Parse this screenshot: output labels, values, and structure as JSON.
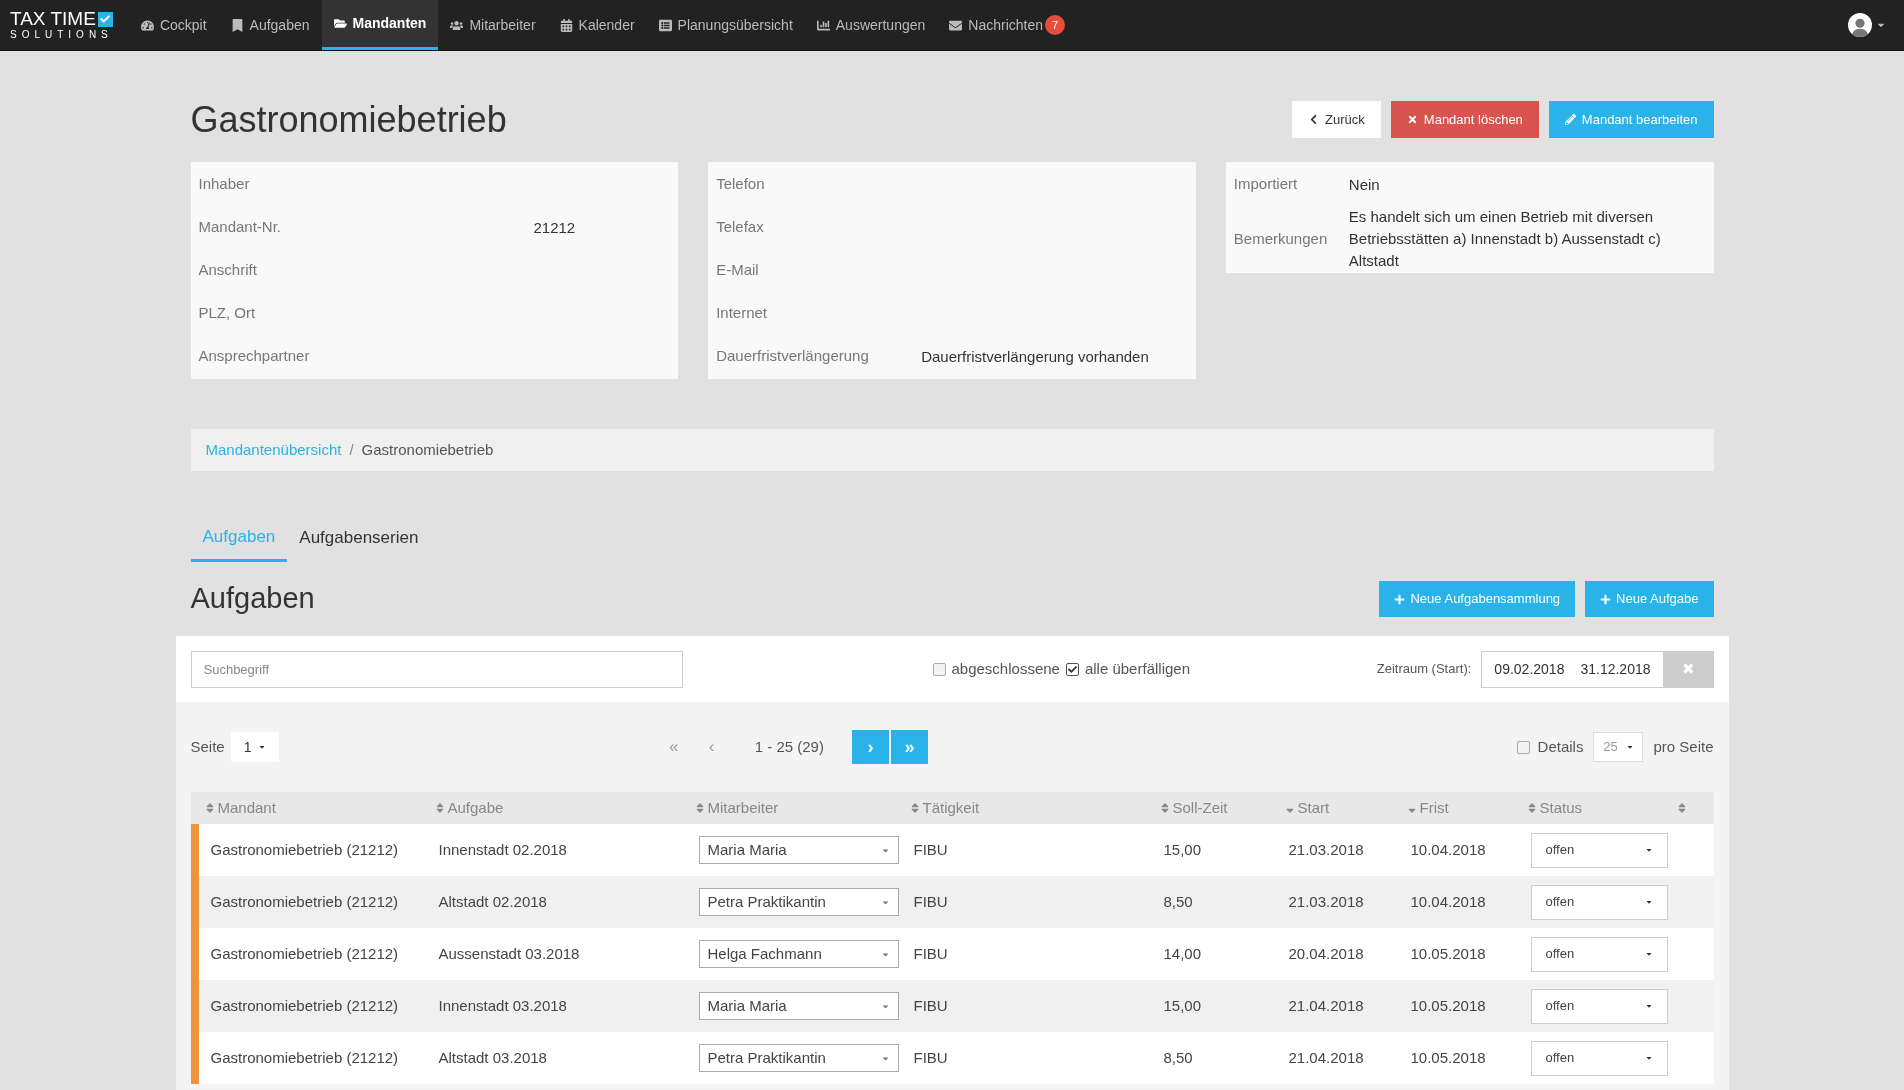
{
  "brand": {
    "line1": "TAX TIME",
    "line2": "SOLUTIONS"
  },
  "nav": [
    {
      "label": "Cockpit",
      "selected": false
    },
    {
      "label": "Aufgaben",
      "selected": false
    },
    {
      "label": "Mandanten",
      "selected": true
    },
    {
      "label": "Mitarbeiter",
      "selected": false
    },
    {
      "label": "Kalender",
      "selected": false
    },
    {
      "label": "Planungsübersicht",
      "selected": false
    },
    {
      "label": "Auswertungen",
      "selected": false
    },
    {
      "label": "Nachrichten",
      "selected": false,
      "badge": "7"
    }
  ],
  "page_title": "Gastronomiebetrieb",
  "header_buttons": [
    {
      "kind": "back",
      "label": "Zurück"
    },
    {
      "kind": "delete",
      "label": "Mandant löschen"
    },
    {
      "kind": "edit",
      "label": "Mandant bearbeiten"
    }
  ],
  "info_cards": [
    [
      {
        "label": "Inhaber"
      },
      {
        "label": "Mandant-Nr.",
        "value": "21212"
      },
      {
        "label": "Anschrift"
      },
      {
        "label": "PLZ, Ort"
      },
      {
        "label": "Ansprechpartner"
      }
    ],
    [
      {
        "label": "Telefon"
      },
      {
        "label": "Telefax"
      },
      {
        "label": "E-Mail"
      },
      {
        "label": "Internet"
      },
      {
        "label": "Dauerfristverlängerung",
        "value": "Dauerfristverlängerung vorhanden"
      }
    ],
    [
      {
        "label": "Importiert",
        "value": "Nein"
      },
      {
        "label": "Bemerkungen",
        "value": "Es handelt sich um einen Betrieb mit diversen Betriebsstätten a) Innenstadt b) Aussenstadt c) Altstadt"
      }
    ]
  ],
  "breadcrumb_separator": "/",
  "breadcrumb": [
    {
      "label": "Mandantenübersicht",
      "link": true
    },
    {
      "label": "Gastronomiebetrieb",
      "link": false
    }
  ],
  "tabs": [
    {
      "label": "Aufgaben",
      "selected": true
    },
    {
      "label": "Aufgabenserien",
      "selected": false
    }
  ],
  "section_title": "Aufgaben",
  "section_buttons": [
    "Neue Aufgabensammlung",
    "Neue Aufgabe"
  ],
  "filter": {
    "search_placeholder": "Suchbegriff",
    "checkboxes": [
      {
        "label": "abgeschlossene",
        "checked": false
      },
      {
        "label": "alle überfälligen",
        "checked": true
      }
    ],
    "period_label": "Zeitraum (Start):",
    "date_from": "09.02.2018",
    "date_to": "31.12.2018",
    "clear": "✖"
  },
  "pagination": {
    "page_label": "Seite",
    "page": "1",
    "range": "1 - 25 (29)",
    "buttons": [
      {
        "label": "«",
        "disabled": true
      },
      {
        "label": "‹",
        "disabled": true
      },
      {
        "label": "›",
        "disabled": false
      },
      {
        "label": "»",
        "disabled": false
      }
    ],
    "details": {
      "label": "Details",
      "checked": false
    },
    "per_page": "25",
    "per_page_label": "pro Seite"
  },
  "table": {
    "columns": [
      {
        "label": "Mandant",
        "sorted_desc": false
      },
      {
        "label": "Aufgabe",
        "sorted_desc": false
      },
      {
        "label": "Mitarbeiter",
        "sorted_desc": false
      },
      {
        "label": "Tätigkeit",
        "sorted_desc": false
      },
      {
        "label": "Soll-Zeit",
        "sorted_desc": false
      },
      {
        "label": "Start",
        "sorted_desc": true
      },
      {
        "label": "Frist",
        "sorted_desc": true
      },
      {
        "label": "Status",
        "sorted_desc": false
      },
      {
        "sorted_desc": false
      }
    ],
    "rows": [
      {
        "mandant": "Gastronomiebetrieb (21212)",
        "aufgabe": "Innenstadt 02.2018",
        "mitarbeiter": "Maria Maria",
        "taetigkeit": "FIBU",
        "soll": "15,00",
        "start": "21.03.2018",
        "frist": "10.04.2018",
        "status": "offen"
      },
      {
        "mandant": "Gastronomiebetrieb (21212)",
        "aufgabe": "Altstadt 02.2018",
        "mitarbeiter": "Petra Praktikantin",
        "taetigkeit": "FIBU",
        "soll": "8,50",
        "start": "21.03.2018",
        "frist": "10.04.2018",
        "status": "offen"
      },
      {
        "mandant": "Gastronomiebetrieb (21212)",
        "aufgabe": "Aussenstadt 03.2018",
        "mitarbeiter": "Helga Fachmann",
        "taetigkeit": "FIBU",
        "soll": "14,00",
        "start": "20.04.2018",
        "frist": "10.05.2018",
        "status": "offen"
      },
      {
        "mandant": "Gastronomiebetrieb (21212)",
        "aufgabe": "Innenstadt 03.2018",
        "mitarbeiter": "Maria Maria",
        "taetigkeit": "FIBU",
        "soll": "15,00",
        "start": "21.04.2018",
        "frist": "10.05.2018",
        "status": "offen"
      },
      {
        "mandant": "Gastronomiebetrieb (21212)",
        "aufgabe": "Altstadt 03.2018",
        "mitarbeiter": "Petra Praktikantin",
        "taetigkeit": "FIBU",
        "soll": "8,50",
        "start": "21.04.2018",
        "frist": "10.05.2018",
        "status": "offen"
      }
    ]
  }
}
